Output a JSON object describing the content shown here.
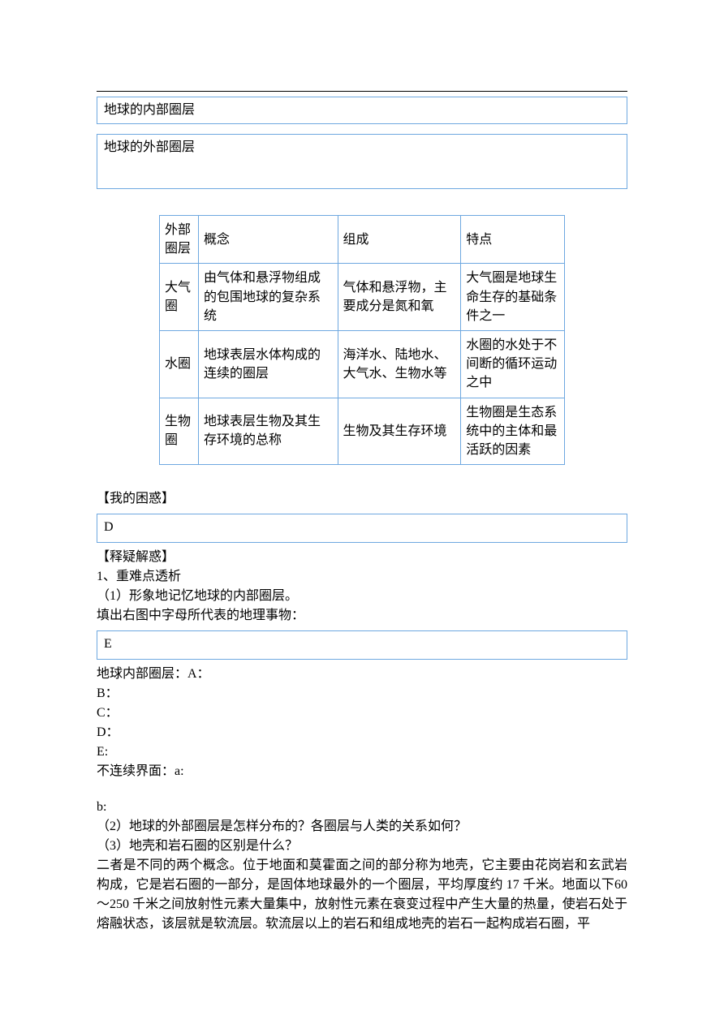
{
  "boxes": {
    "internal_layers": "地球的内部圈层",
    "external_layers": "地球的外部圈层"
  },
  "table": {
    "header": {
      "layer": "外部圈层",
      "concept": "概念",
      "composition": "组成",
      "feature": "特点"
    },
    "rows": [
      {
        "layer": "大气圈",
        "concept": "由气体和悬浮物组成的包围地球的复杂系统",
        "composition": "气体和悬浮物，主要成分是氮和氧",
        "feature": "大气圈是地球生命生存的基础条件之一"
      },
      {
        "layer": "水圈",
        "concept": "地球表层水体构成的连续的圈层",
        "composition": "海洋水、陆地水、大气水、生物水等",
        "feature": "水圈的水处于不间断的循环运动之中"
      },
      {
        "layer": "生物圈",
        "concept": "地球表层生物及其生存环境的总称",
        "composition": "生物及其生存环境",
        "feature": "生物圈是生态系统中的主体和最活跃的因素"
      }
    ]
  },
  "sections": {
    "confusion": "【我的困惑】",
    "box_d": "D",
    "resolve": "【释疑解惑】",
    "point1": "1、重难点透析",
    "sub1": "（1）形象地记忆地球的内部圈层。",
    "fill_prompt": "填出右图中字母所代表的地理事物：",
    "box_e": "E",
    "internal_layers_label": "地球内部圈层：A：",
    "line_b": "B：",
    "line_c": "C：",
    "line_d": "D：",
    "line_e": "E:",
    "discontinuous": "不连续界面：a:",
    "line_lower_b": "b:",
    "sub2": "（2）地球的外部圈层是怎样分布的？各圈层与人类的关系如何？",
    "sub3": "（3）地壳和岩石圈的区别是什么？",
    "para1": "二者是不同的两个概念。位于地面和莫霍面之间的部分称为地壳，它主要由花岗岩和玄武岩构成，它是岩石圈的一部分，是固体地球最外的一个圈层，平均厚度约 17 千米。地面以下60～250 千米之间放射性元素大量集中，放射性元素在衰变过程中产生大量的热量，使岩石处于熔融状态，该层就是软流层。软流层以上的岩石和组成地壳的岩石一起构成岩石圈，平"
  }
}
